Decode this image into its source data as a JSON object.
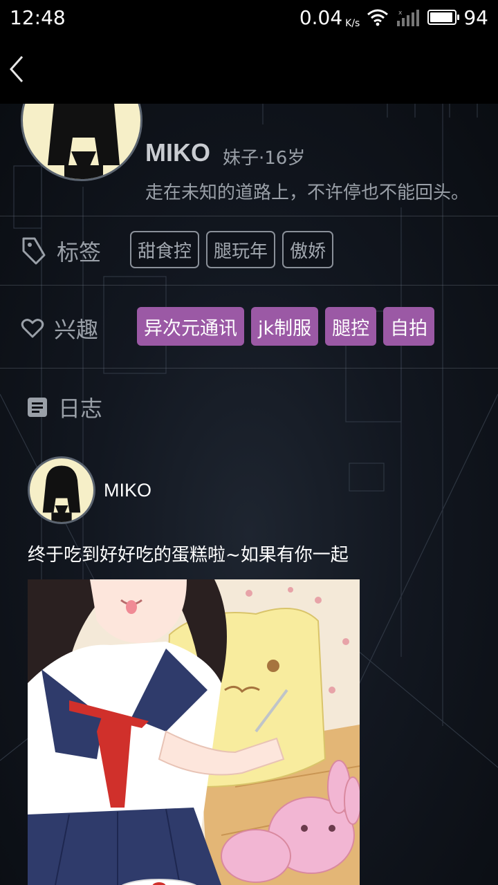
{
  "status_bar": {
    "time": "12:48",
    "net_speed": "0.04",
    "net_unit": "K/s",
    "battery": "94",
    "battery_level": 0.94
  },
  "nav": {
    "back_icon": "chevron-left-icon"
  },
  "profile": {
    "name": "MIKO",
    "meta": "妹子·16岁",
    "bio": "走在未知的道路上，不许停也不能回头。"
  },
  "tags_section": {
    "label": "标签",
    "icon": "tag-icon",
    "tags": [
      "甜食控",
      "腿玩年",
      "傲娇"
    ]
  },
  "interests_section": {
    "label": "兴趣",
    "icon": "heart-icon",
    "tags": [
      "异次元通讯",
      "jk制服",
      "腿控",
      "自拍"
    ],
    "tag_color": "#9b59a5"
  },
  "diary_section": {
    "label": "日志",
    "icon": "document-icon"
  },
  "post": {
    "author": "MIKO",
    "text": "终于吃到好好吃的蛋糕啦~如果有你一起"
  }
}
